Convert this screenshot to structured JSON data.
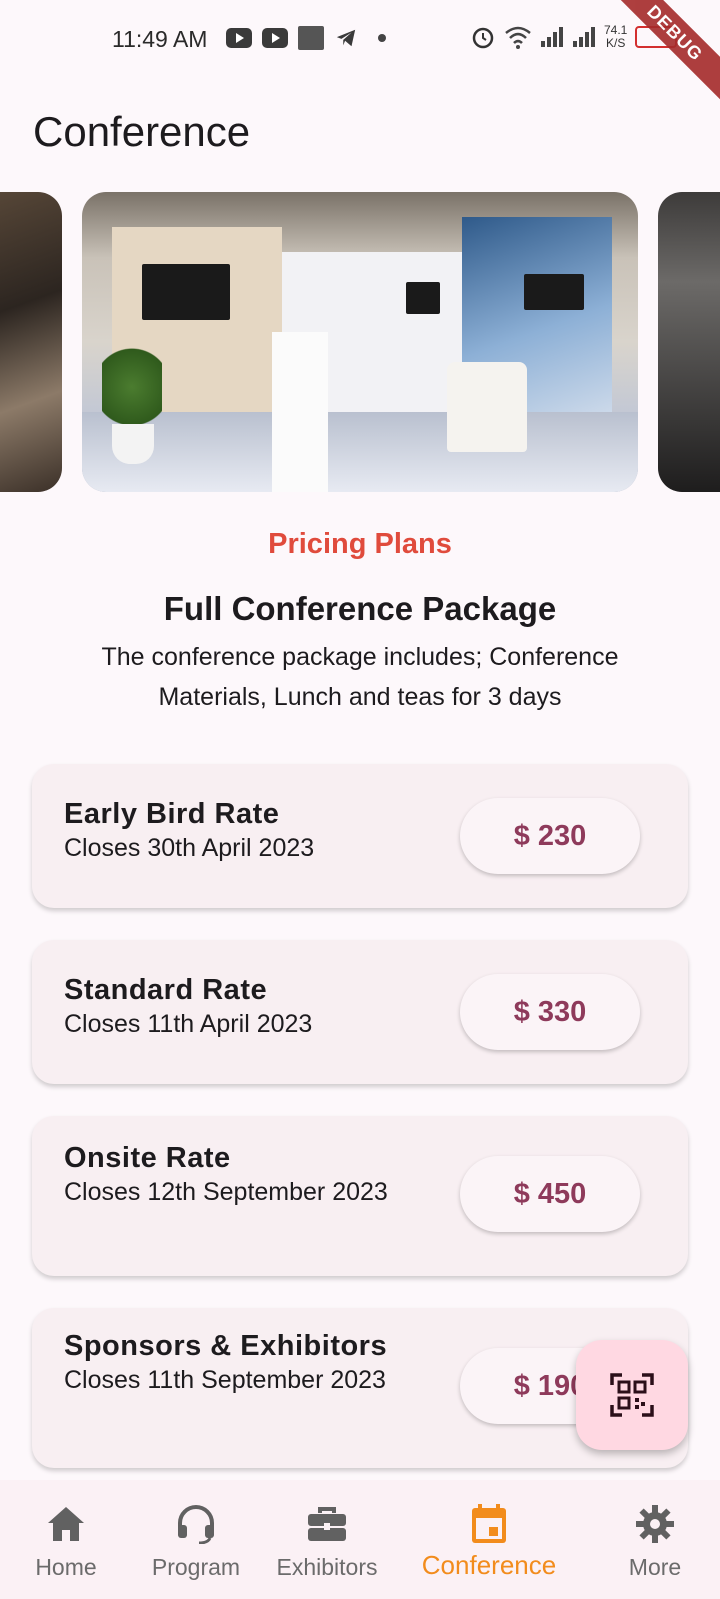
{
  "status_bar": {
    "time": "11:49 AM",
    "network_speed": "74.1",
    "network_speed_unit": "K/S"
  },
  "debug_banner": "DEBUG",
  "page": {
    "title": "Conference"
  },
  "carousel": {
    "slide_count_visible": 3
  },
  "pricing": {
    "kicker": "Pricing Plans",
    "kicker_color": "#e04b3c",
    "package_title": "Full Conference Package",
    "package_description": "The conference package includes; Conference Materials, Lunch and teas for 3 days",
    "plans": [
      {
        "name": "Early Bird Rate",
        "closes": "Closes 30th April 2023",
        "price": "$ 230"
      },
      {
        "name": "Standard Rate",
        "closes": "Closes 11th April 2023",
        "price": "$ 330"
      },
      {
        "name": "Onsite Rate",
        "closes": "Closes 12th September 2023",
        "price": "$ 450"
      },
      {
        "name": "Sponsors & Exhibitors",
        "closes": "Closes 11th September 2023",
        "price": "$ 190"
      }
    ]
  },
  "fab": {
    "icon": "qr-scanner-icon"
  },
  "bottom_nav": {
    "active_color": "#f28c1c",
    "items": [
      {
        "label": "Home",
        "icon": "home-icon"
      },
      {
        "label": "Program",
        "icon": "headset-icon"
      },
      {
        "label": "Exhibitors",
        "icon": "briefcase-icon"
      },
      {
        "label": "Conference",
        "icon": "calendar-icon",
        "active": true
      },
      {
        "label": "More",
        "icon": "gear-icon"
      }
    ]
  }
}
